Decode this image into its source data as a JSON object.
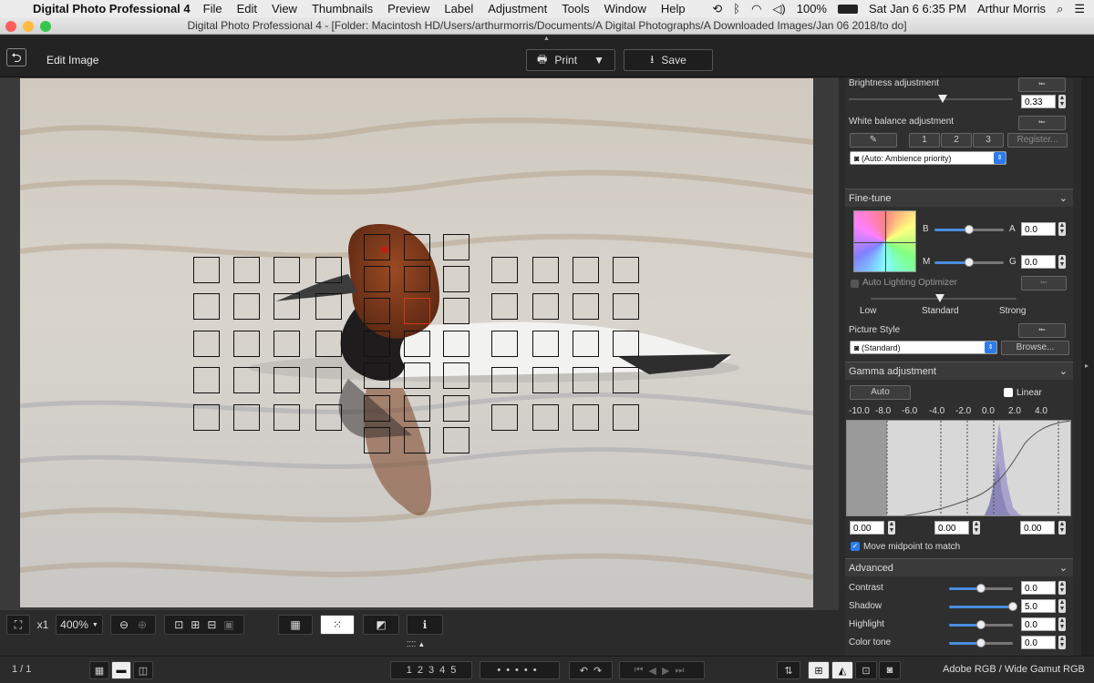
{
  "menubar": {
    "app_name": "Digital Photo Professional 4",
    "items": [
      "File",
      "Edit",
      "View",
      "Thumbnails",
      "Preview",
      "Label",
      "Adjustment",
      "Tools",
      "Window",
      "Help"
    ],
    "battery": "100%",
    "clock": "Sat Jan 6  6:35 PM",
    "user": "Arthur Morris"
  },
  "window": {
    "title": "Digital Photo Professional 4 - [Folder: Macintosh HD/Users/arthurmorris/Documents/A Digital Photographs/A Downloaded Images/Jan 06 2018/to do]"
  },
  "toolbar": {
    "back_icon": "undo-arrow-icon",
    "edit_label": "Edit Image",
    "print_label": "Print",
    "save_label": "Save"
  },
  "panel": {
    "brightness": {
      "label": "Brightness adjustment",
      "value": "0.33"
    },
    "white_balance": {
      "label": "White balance adjustment",
      "slots": [
        "1",
        "2",
        "3"
      ],
      "register_label": "Register...",
      "preset": "(Auto: Ambience priority)"
    },
    "finetune": {
      "header": "Fine-tune",
      "b_label": "B",
      "a_label": "A",
      "ba_value": "0.0",
      "m_label": "M",
      "g_label": "G",
      "mg_value": "0.0",
      "alo_label": "Auto Lighting Optimizer",
      "alo_levels": [
        "Low",
        "Standard",
        "Strong"
      ],
      "picture_style_label": "Picture Style",
      "picture_style_value": "(Standard)",
      "browse_label": "Browse..."
    },
    "gamma": {
      "header": "Gamma adjustment",
      "auto_label": "Auto",
      "linear_label": "Linear",
      "scale": [
        "-10.0",
        "-8.0",
        "-6.0",
        "-4.0",
        "-2.0",
        "0.0",
        "2.0",
        "4.0"
      ],
      "values": [
        "0.00",
        "0.00",
        "0.00"
      ],
      "midpoint_label": "Move midpoint to match"
    },
    "advanced": {
      "header": "Advanced",
      "rows": [
        {
          "label": "Contrast",
          "value": "0.0",
          "level": 0.5
        },
        {
          "label": "Shadow",
          "value": "5.0",
          "level": 1.0
        },
        {
          "label": "Highlight",
          "value": "0.0",
          "level": 0.5
        },
        {
          "label": "Color tone",
          "value": "0.0",
          "level": 0.5
        }
      ]
    }
  },
  "viewer_controls": {
    "x1_label": "x1",
    "zoom_value": "400%"
  },
  "status": {
    "counter": "1 / 1",
    "rating_marks": [
      "1",
      "2",
      "3",
      "4",
      "5"
    ],
    "color_space": "Adobe RGB / Wide Gamut RGB"
  },
  "colors": {
    "accent": "#2d7bea",
    "af_point_active": "#d03a1e"
  }
}
